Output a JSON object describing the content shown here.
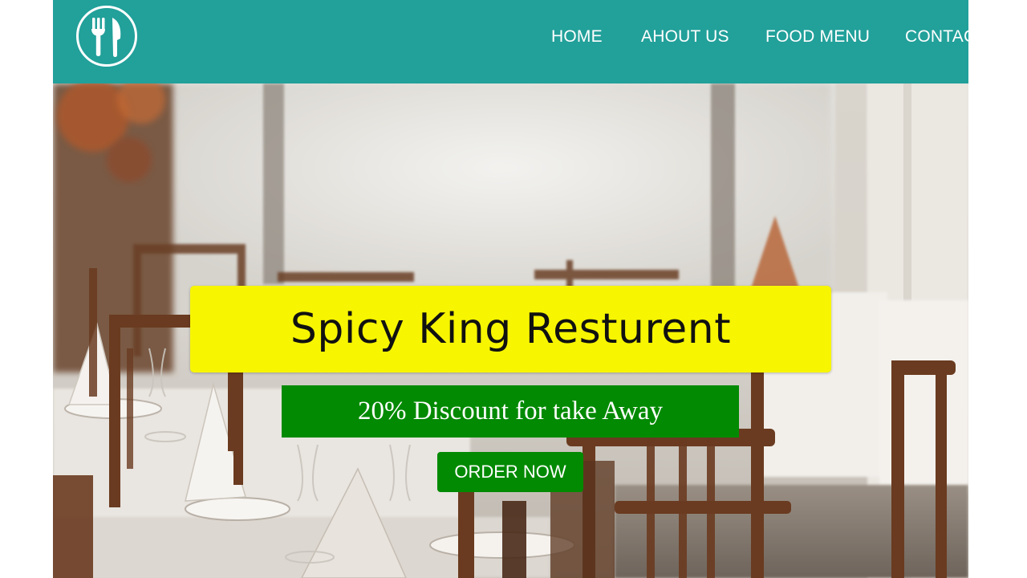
{
  "header": {
    "logo_icon": "fork-knife-icon",
    "nav": [
      {
        "label": "HOME"
      },
      {
        "label": "AHOUT US"
      },
      {
        "label": "FOOD MENU"
      },
      {
        "label": "CONTACT"
      }
    ]
  },
  "hero": {
    "title": "Spicy King Resturent",
    "discount": "20% Discount for take Away",
    "order_button": "ORDER NOW"
  },
  "colors": {
    "header_bg": "#22a09a",
    "title_bg": "#f7f500",
    "accent_green": "#028a02"
  }
}
